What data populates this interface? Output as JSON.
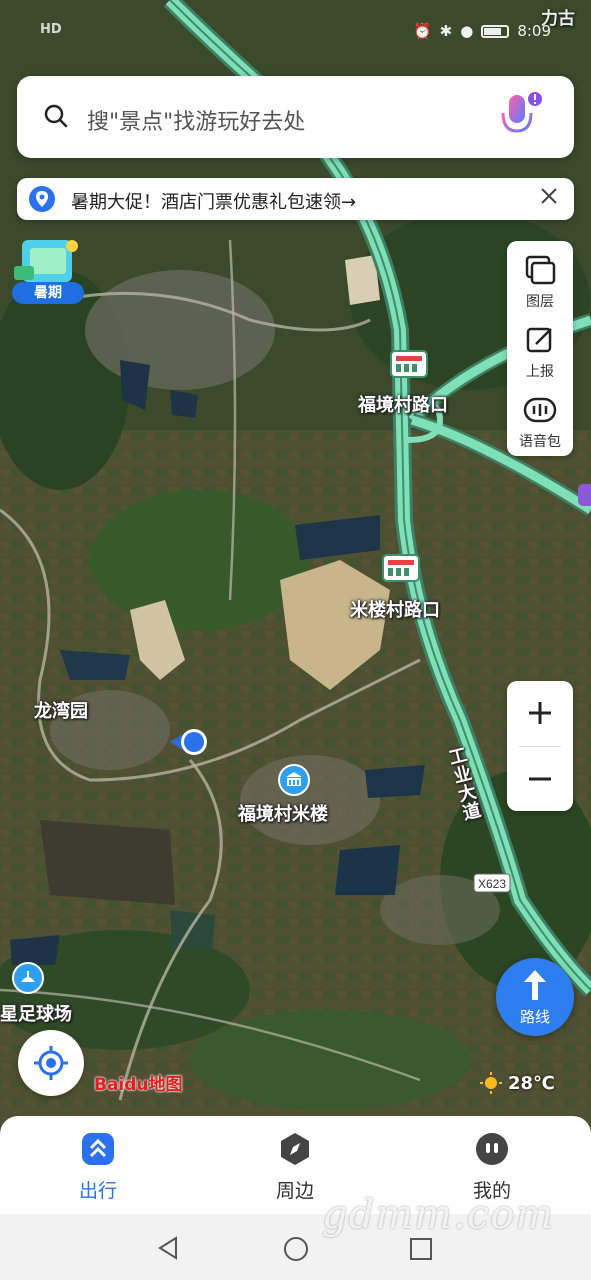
{
  "status_bar": {
    "left_text": "HD",
    "time": "8:09"
  },
  "search": {
    "placeholder": "搜\"景点\"找游玩好去处"
  },
  "promo": {
    "text": "暑期大促！酒店门票优惠礼包速领→"
  },
  "summer_badge": {
    "label": "暑期"
  },
  "tools": [
    {
      "label": "图层",
      "icon": "layers-icon"
    },
    {
      "label": "上报",
      "icon": "report-icon"
    },
    {
      "label": "语音包",
      "icon": "voice-pack-icon"
    }
  ],
  "map_labels": {
    "top_right_partial": "力古",
    "toll_1": "福境村路口",
    "toll_2": "米楼村路口",
    "village_1": "龙湾园",
    "poi_main": "福境村米楼",
    "road_name": "工业大道",
    "road_code": "X623",
    "poi_left": "星足球场"
  },
  "route_button": {
    "label": "路线"
  },
  "logo": {
    "text": "Baidu地图"
  },
  "weather": {
    "temperature": "28℃"
  },
  "tabs": [
    {
      "label": "出行",
      "active": true,
      "icon": "travel-icon"
    },
    {
      "label": "周边",
      "active": false,
      "icon": "compass-icon"
    },
    {
      "label": "我的",
      "active": false,
      "icon": "profile-icon"
    }
  ],
  "watermark": "gdmm.com",
  "colors": {
    "accent": "#2a72ec",
    "highway": "#7fe0b8",
    "satellite": "#3b4a2c"
  }
}
